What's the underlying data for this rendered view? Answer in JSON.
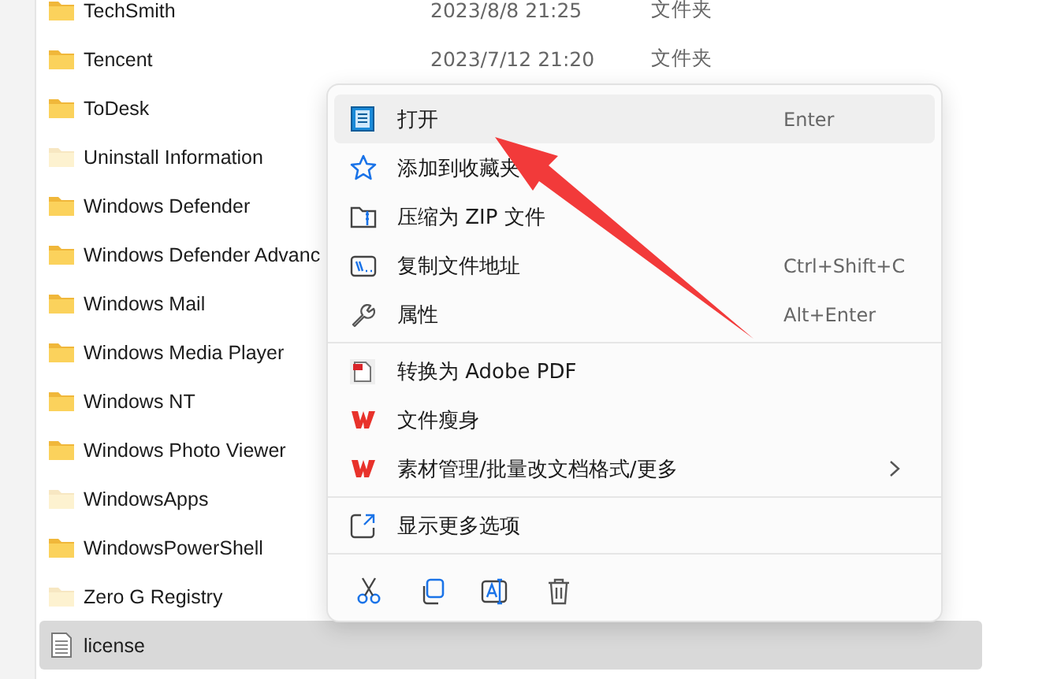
{
  "files": [
    {
      "name": "TechSmith",
      "kind": "folder",
      "hidden": false,
      "selected": false,
      "date": "2023/8/8 21:25",
      "type": "文件夹"
    },
    {
      "name": "Tencent",
      "kind": "folder",
      "hidden": false,
      "selected": false,
      "date": "2023/7/12 21:20",
      "type": "文件夹"
    },
    {
      "name": "ToDesk",
      "kind": "folder",
      "hidden": false,
      "selected": false
    },
    {
      "name": "Uninstall Information",
      "kind": "folder",
      "hidden": true,
      "selected": false
    },
    {
      "name": "Windows Defender",
      "kind": "folder",
      "hidden": false,
      "selected": false
    },
    {
      "name": "Windows Defender Advanc",
      "kind": "folder",
      "hidden": false,
      "selected": false
    },
    {
      "name": "Windows Mail",
      "kind": "folder",
      "hidden": false,
      "selected": false
    },
    {
      "name": "Windows Media Player",
      "kind": "folder",
      "hidden": false,
      "selected": false
    },
    {
      "name": "Windows NT",
      "kind": "folder",
      "hidden": false,
      "selected": false
    },
    {
      "name": "Windows Photo Viewer",
      "kind": "folder",
      "hidden": false,
      "selected": false
    },
    {
      "name": "WindowsApps",
      "kind": "folder",
      "hidden": true,
      "selected": false
    },
    {
      "name": "WindowsPowerShell",
      "kind": "folder",
      "hidden": false,
      "selected": false
    },
    {
      "name": "Zero G Registry",
      "kind": "folder",
      "hidden": true,
      "selected": false
    },
    {
      "name": "license",
      "kind": "file",
      "hidden": false,
      "selected": true
    }
  ],
  "context_menu": {
    "groups": [
      [
        {
          "label": "打开",
          "shortcut": "Enter",
          "selected": true,
          "submenu": false
        },
        {
          "label": "添加到收藏夹",
          "selected": false,
          "submenu": false
        },
        {
          "label": "压缩为 ZIP 文件",
          "selected": false,
          "submenu": false
        },
        {
          "label": "复制文件地址",
          "shortcut": "Ctrl+Shift+C",
          "selected": false,
          "submenu": false
        },
        {
          "label": "属性",
          "shortcut": "Alt+Enter",
          "selected": false,
          "submenu": false
        }
      ],
      [
        {
          "label": "转换为 Adobe PDF",
          "selected": false,
          "submenu": false
        },
        {
          "label": "文件瘦身",
          "selected": false,
          "submenu": false
        },
        {
          "label": "素材管理/批量改文档格式/更多",
          "selected": false,
          "submenu": true
        }
      ],
      [
        {
          "label": "显示更多选项",
          "selected": false,
          "submenu": false
        }
      ]
    ]
  }
}
